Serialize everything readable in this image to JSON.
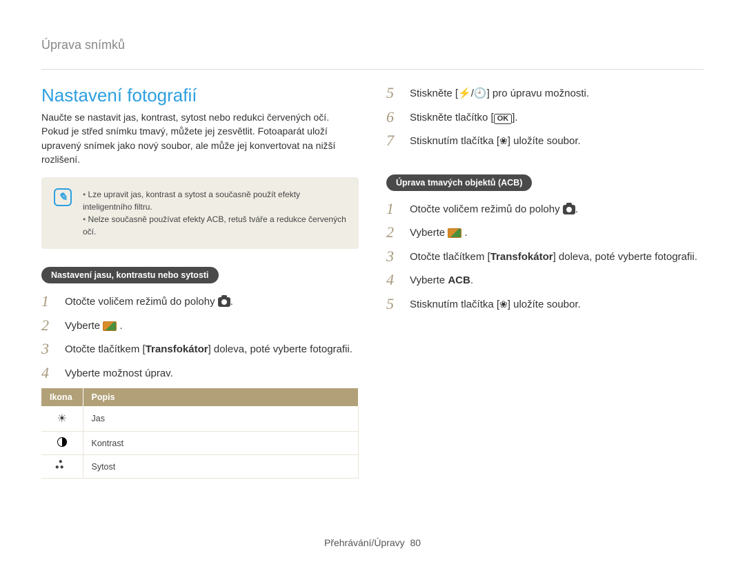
{
  "chapter": "Úprava snímků",
  "title": "Nastavení fotografií",
  "intro": "Naučte se nastavit jas, kontrast, sytost nebo redukci červených očí. Pokud je střed snímku tmavý, můžete jej zesvětlit. Fotoaparát uloží upravený snímek jako nový soubor, ale může jej konvertovat na nižší rozlišení.",
  "note": {
    "items": [
      "Lze upravit jas, kontrast a sytost a současně použít efekty inteligentního filtru.",
      "Nelze současně používat efekty ACB, retuš tváře a redukce červených očí."
    ]
  },
  "left_section": {
    "heading": "Nastavení jasu, kontrastu nebo sytosti",
    "steps": [
      {
        "n": "1",
        "text_a": "Otočte voličem režimů do polohy ",
        "icon": "camera",
        "text_b": "."
      },
      {
        "n": "2",
        "text_a": "Vyberte ",
        "icon": "edit",
        "text_b": " ."
      },
      {
        "n": "3",
        "text_a": "Otočte tlačítkem [",
        "bold": "Transfokátor",
        "text_b": "] doleva, poté vyberte fotografii."
      },
      {
        "n": "4",
        "text_a": "Vyberte možnost úprav."
      }
    ],
    "table": {
      "headers": [
        "Ikona",
        "Popis"
      ],
      "rows": [
        {
          "icon": "brightness",
          "label": "Jas"
        },
        {
          "icon": "contrast",
          "label": "Kontrast"
        },
        {
          "icon": "saturation",
          "label": "Sytost"
        }
      ]
    }
  },
  "right_top_steps": [
    {
      "n": "5",
      "text_a": "Stiskněte [",
      "icons": "bolt-timer",
      "text_b": "] pro úpravu možnosti."
    },
    {
      "n": "6",
      "text_a": "Stiskněte tlačítko [",
      "icons": "ok",
      "text_b": "]."
    },
    {
      "n": "7",
      "text_a": "Stisknutím tlačítka [",
      "icons": "flower",
      "text_b": "] uložíte soubor."
    }
  ],
  "right_section": {
    "heading": "Úprava tmavých objektů (ACB)",
    "steps": [
      {
        "n": "1",
        "text_a": "Otočte voličem režimů do polohy ",
        "icon": "camera",
        "text_b": "."
      },
      {
        "n": "2",
        "text_a": "Vyberte ",
        "icon": "edit",
        "text_b": " ."
      },
      {
        "n": "3",
        "text_a": "Otočte tlačítkem [",
        "bold": "Transfokátor",
        "text_b": "] doleva, poté vyberte fotografii."
      },
      {
        "n": "4",
        "text_a": "Vyberte ",
        "bold": "ACB",
        "text_b": "."
      },
      {
        "n": "5",
        "text_a": "Stisknutím tlačítka [",
        "icons": "flower",
        "text_b": "] uložíte soubor."
      }
    ]
  },
  "footer": {
    "section": "Přehrávání/Úpravy",
    "page": "80"
  }
}
